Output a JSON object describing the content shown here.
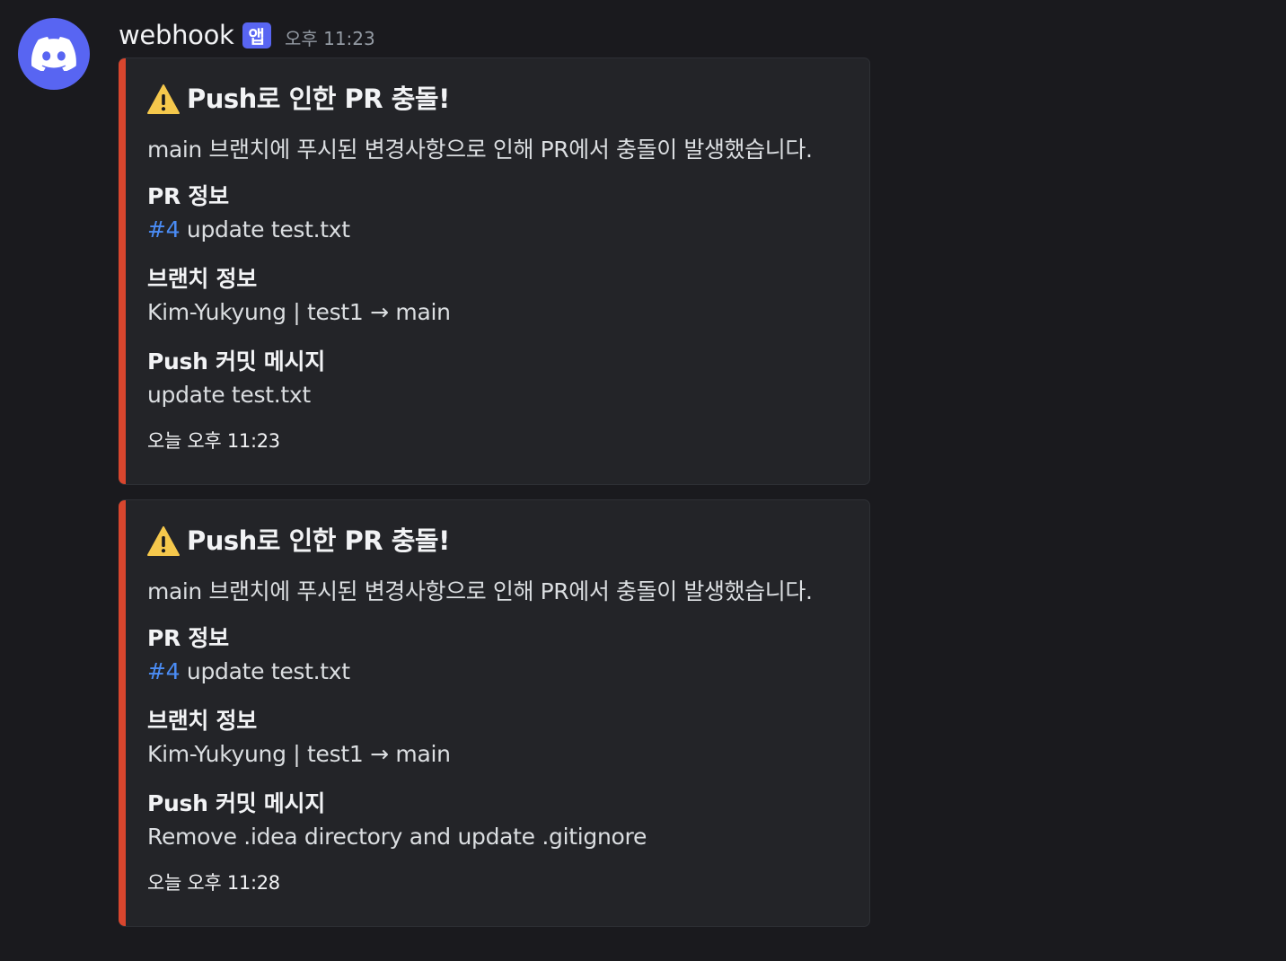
{
  "message": {
    "username": "webhook",
    "app_badge": "앱",
    "timestamp": "오후 11:23",
    "avatar_icon": "discord-logo-icon"
  },
  "colors": {
    "background": "#1a1a1e",
    "embed_background": "#232428",
    "embed_bar": "#d8462e",
    "badge": "#5865f2",
    "avatar": "#5865f2",
    "link": "#4a8cf5",
    "warning_icon": "#f5c84c"
  },
  "embeds": [
    {
      "icon": "warning-icon",
      "title": "Push로 인한 PR 충돌!",
      "description": "main 브랜치에 푸시된 변경사항으로 인해 PR에서 충돌이 발생했습니다.",
      "fields": [
        {
          "name": "PR 정보",
          "value_link": "#4",
          "value_text": " update test.txt"
        },
        {
          "name": "브랜치 정보",
          "value": "Kim-Yukyung | test1 → main"
        },
        {
          "name": "Push 커밋 메시지",
          "value": "update test.txt"
        }
      ],
      "footer": "오늘 오후 11:23"
    },
    {
      "icon": "warning-icon",
      "title": "Push로 인한 PR 충돌!",
      "description": "main 브랜치에 푸시된 변경사항으로 인해 PR에서 충돌이 발생했습니다.",
      "fields": [
        {
          "name": "PR 정보",
          "value_link": "#4",
          "value_text": " update test.txt"
        },
        {
          "name": "브랜치 정보",
          "value": "Kim-Yukyung | test1 → main"
        },
        {
          "name": "Push 커밋 메시지",
          "value": "Remove .idea directory and update .gitignore"
        }
      ],
      "footer": "오늘 오후 11:28"
    }
  ]
}
